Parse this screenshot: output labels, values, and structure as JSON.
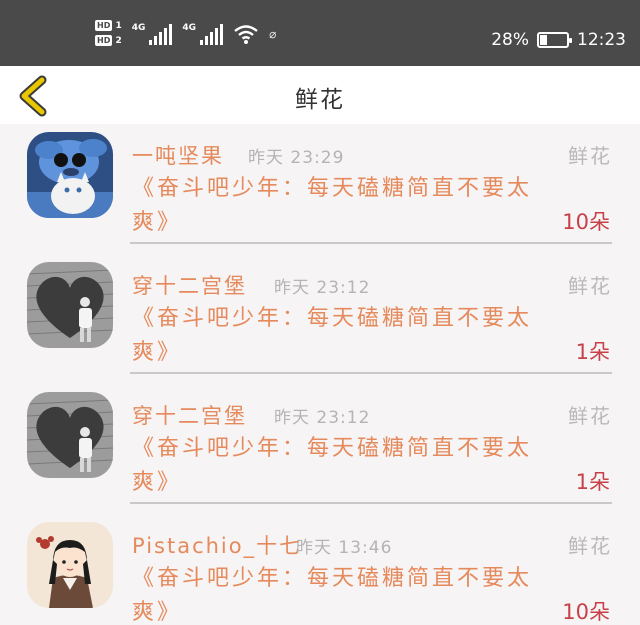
{
  "status_bar": {
    "hd1": "HD",
    "hd1_num": "1",
    "hd2": "HD",
    "hd2_num": "2",
    "net1": "4G",
    "net2": "4G",
    "battery_percent": "28%",
    "battery_level": 0.28,
    "time": "12:23"
  },
  "header": {
    "back_icon": "chevron-left-icon",
    "title": "鲜花",
    "accent_color": "#e8c600"
  },
  "colors": {
    "name": "#e58a5c",
    "count": "#c74148",
    "muted": "#b4b4b4"
  },
  "items": [
    {
      "name": "一吨坚果",
      "time": "昨天 23:29",
      "gift": "鲜花",
      "message": "《奋斗吧少年：每天磕糖简直不要太爽》",
      "count": "10朵",
      "avatar": "stitch-cat-avatar"
    },
    {
      "name": "穿十二宫堡",
      "time": "昨天 23:12",
      "gift": "鲜花",
      "message": "《奋斗吧少年：每天磕糖简直不要太爽》",
      "count": "1朵",
      "avatar": "heart-wall-avatar"
    },
    {
      "name": "穿十二宫堡",
      "time": "昨天 23:12",
      "gift": "鲜花",
      "message": "《奋斗吧少年：每天磕糖简直不要太爽》",
      "count": "1朵",
      "avatar": "heart-wall-avatar"
    },
    {
      "name": "Pistachio_十七",
      "time": "昨天 13:46",
      "gift": "鲜花",
      "message": "《奋斗吧少年：每天磕糖简直不要太爽》",
      "count": "10朵",
      "avatar": "cartoon-girl-avatar"
    }
  ]
}
